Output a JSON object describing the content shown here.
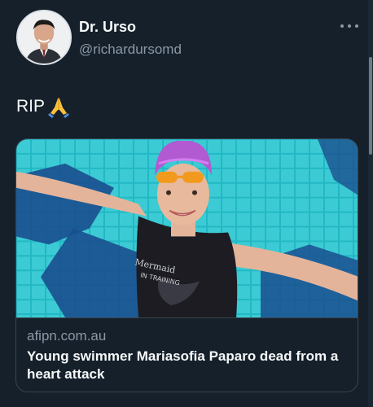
{
  "author": {
    "display_name": "Dr. Urso",
    "handle": "@richardursomd",
    "avatar_icon": "avatar-photo"
  },
  "tweet": {
    "text": "RIP",
    "emoji_icon": "folded-hands-icon"
  },
  "more_icon": "more-horizontal-icon",
  "link_card": {
    "domain": "afipn.com.au",
    "title": "Young swimmer Mariasofia Paparo dead from a heart attack",
    "swimsuit_text": "Mermaid IN TRAINING"
  },
  "colors": {
    "background": "#15202b",
    "primary_text": "#f7f9f9",
    "secondary_text": "#8b98a5",
    "border": "#38444d",
    "pool_water": "#23b9c4",
    "cap": "#b15ad1"
  }
}
